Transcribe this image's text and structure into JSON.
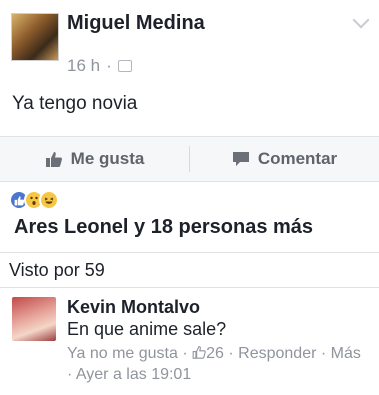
{
  "post": {
    "author": "Miguel Medina",
    "time": "16 h",
    "separator": "·",
    "text": "Ya tengo novia"
  },
  "actions": {
    "like_label": "Me gusta",
    "comment_label": "Comentar"
  },
  "reactions": {
    "summary": "Ares Leonel y 18 personas más",
    "icons": [
      "like-reaction",
      "wow-reaction",
      "haha-reaction"
    ]
  },
  "seen": {
    "label": "Visto por 59"
  },
  "comment": {
    "author": "Kevin Montalvo",
    "text": "En que anime sale?",
    "unlike_label": "Ya no me gusta",
    "sep1": "·",
    "likes_count": "26",
    "sep2": "·",
    "reply_label": "Responder",
    "sep3": "·",
    "more_label": "Más",
    "sep4": "·",
    "timestamp": "Ayer a las 19:01"
  },
  "colors": {
    "text": "#1d2129",
    "muted": "#90949c",
    "facebook_blue": "#4a76ce",
    "reaction_yellow": "#f6c744"
  }
}
